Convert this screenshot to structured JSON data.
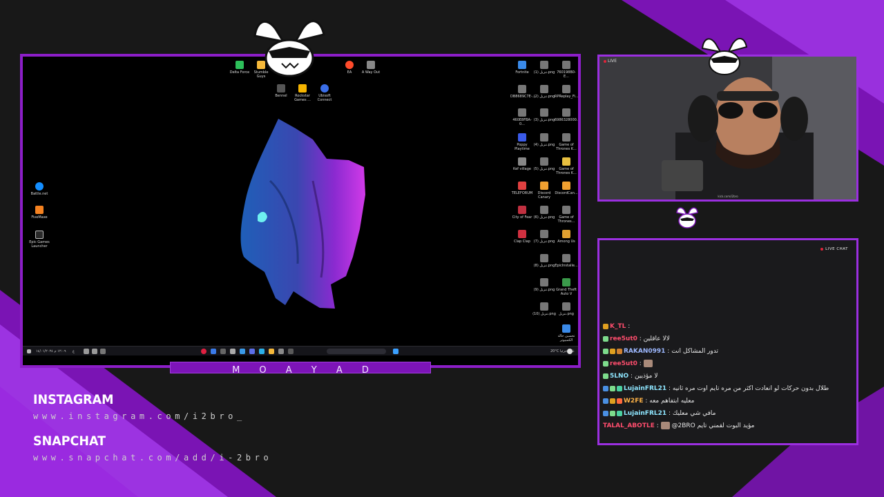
{
  "colors": {
    "accent": "#8c1ec8",
    "accent_light": "#a23ee0",
    "background": "#181818"
  },
  "overlay": {
    "streamer_name": "M O A Y A D",
    "socials": [
      {
        "title": "INSTAGRAM",
        "url": "www.instagram.com/i2bro_"
      },
      {
        "title": "SNAPCHAT",
        "url": "www.snapchat.com/add/i-2bro"
      }
    ]
  },
  "desktop": {
    "icons_top": [
      {
        "label": "Delta Force",
        "icon": "delta-force-icon"
      },
      {
        "label": "Stumble Guys",
        "icon": "stumble-guys-icon"
      },
      {
        "label": "EA",
        "icon": "ea-icon"
      },
      {
        "label": "A Way Out",
        "icon": "a-way-out-icon"
      },
      {
        "label": "Bennel",
        "icon": "bennel-icon"
      },
      {
        "label": "Rockstar Games ...",
        "icon": "rockstar-icon"
      },
      {
        "label": "Ubisoft Connect",
        "icon": "ubisoft-icon"
      }
    ],
    "icons_left": [
      {
        "label": "Battle.net",
        "icon": "battlenet-icon"
      },
      {
        "label": "FiveMaxe",
        "icon": "fivem-icon"
      },
      {
        "label": "Epic Games Launcher",
        "icon": "epic-games-icon"
      }
    ],
    "icons_right": [
      {
        "label": "Fortnite",
        "icon": "fortnite-icon"
      },
      {
        "label": "تنزيل (1).png",
        "icon": "file-icon"
      },
      {
        "label": "760198B0-E...",
        "icon": "file-icon"
      },
      {
        "label": "DB8689C7E-...",
        "icon": "file-icon"
      },
      {
        "label": "تنزيل (2).png",
        "icon": "file-icon"
      },
      {
        "label": "RPReplay_Fi...",
        "icon": "file-icon"
      },
      {
        "label": "460E8FBA-0...",
        "icon": "file-icon"
      },
      {
        "label": "تنزيل (3).png",
        "icon": "file-icon"
      },
      {
        "label": "6986328000...",
        "icon": "file-icon"
      },
      {
        "label": "Poppy Playtime",
        "icon": "poppy-icon"
      },
      {
        "label": "تنزيل (4).png",
        "icon": "file-icon"
      },
      {
        "label": "Game of Thrones K...",
        "icon": "file-icon"
      },
      {
        "label": "Kef village",
        "icon": "kef-icon"
      },
      {
        "label": "تنزيل (5).png",
        "icon": "file-icon"
      },
      {
        "label": "Game of Thrones K...",
        "icon": "folder-icon"
      },
      {
        "label": "TELEFORUM",
        "icon": "teleforum-icon"
      },
      {
        "label": "Discord Canary",
        "icon": "discord-icon"
      },
      {
        "label": "DiscordCan...",
        "icon": "discord-icon"
      },
      {
        "label": "City of Fear",
        "icon": "city-of-fear-icon"
      },
      {
        "label": "تنزيل (6).png",
        "icon": "file-icon"
      },
      {
        "label": "Game of Thrones...",
        "icon": "file-icon"
      },
      {
        "label": "Clap Clap",
        "icon": "clap-icon"
      },
      {
        "label": "تنزيل (7).png",
        "icon": "file-icon"
      },
      {
        "label": "Among Us",
        "icon": "among-us-icon"
      },
      {
        "label": "تنزيل (8).png",
        "icon": "file-icon"
      },
      {
        "label": "EpicInstalle...",
        "icon": "file-icon"
      },
      {
        "label": "تنزيل (9).png",
        "icon": "file-icon"
      },
      {
        "label": "Grand Theft Auto V",
        "icon": "gta-icon"
      },
      {
        "label": "تنزيل (10).png",
        "icon": "file-icon"
      },
      {
        "label": "تنزيل.png",
        "icon": "file-icon"
      },
      {
        "label": "تحسين حالة الكمبيوتر",
        "icon": "pc-health-icon"
      }
    ],
    "taskbar": {
      "clock_time": "١٢:٠٩ م",
      "clock_date": "١٤/٠١/٢٠٢٤",
      "language": "ع",
      "weather_temp": "20°C",
      "weather_desc": "غائم جزئيا"
    }
  },
  "camera": {
    "live_label": "LIVE",
    "url": "kick.com/i2bro"
  },
  "chat": {
    "header": "LIVE CHAT",
    "messages": [
      {
        "user": "K_TL",
        "color": "#ff4d6d",
        "text": "",
        "badges": [
          "#e0a020"
        ]
      },
      {
        "user": "ree5ut0",
        "color": "#ff4d6d",
        "text": "لالا عاقلين",
        "badges": [
          "#7ddc8c"
        ]
      },
      {
        "user": "RAKAN0991",
        "color": "#9db8ff",
        "text": "تدور المشاكل انت",
        "badges": [
          "#7ddc8c",
          "#e0a020",
          "#d08030"
        ]
      },
      {
        "user": "ree5ut0",
        "color": "#ff4d6d",
        "text": "",
        "badges": [
          "#7ddc8c"
        ],
        "emote": true
      },
      {
        "user": "5LNO",
        "color": "#8ee6ff",
        "text": "لا مؤذيين",
        "badges": [
          "#7ddc8c"
        ]
      },
      {
        "user": "LujainFRL21",
        "color": "#8ee6ff",
        "text": "طلال بدون حركات لو انعادت اكثر من مره تايم اوت مره ثانيه",
        "badges": [
          "#4a90e2",
          "#7ddc8c",
          "#4ad0a0"
        ]
      },
      {
        "user": "W2FE",
        "color": "#ffb347",
        "text": "معليه ابتفاهم معه",
        "badges": [
          "#4a90e2",
          "#e0a020",
          "#ff6a3d"
        ]
      },
      {
        "user": "LujainFRL21",
        "color": "#8ee6ff",
        "text": "مافي شي معليك",
        "badges": [
          "#4a90e2",
          "#7ddc8c",
          "#4ad0a0"
        ]
      },
      {
        "user": "TALAL_ABOTLE",
        "color": "#ff4d6d",
        "text": "@2BRO مؤيد البوت لقمني تايم",
        "badges": [],
        "emote": true
      }
    ]
  }
}
